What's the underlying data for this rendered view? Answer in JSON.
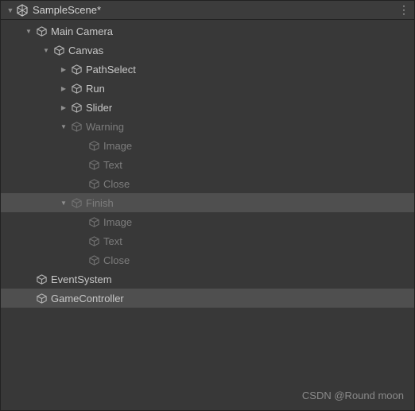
{
  "header": {
    "title": "SampleScene*"
  },
  "tree": {
    "mainCamera": "Main Camera",
    "canvas": "Canvas",
    "pathSelect": "PathSelect",
    "run": "Run",
    "slider": "Slider",
    "warning": "Warning",
    "warningImage": "Image",
    "warningText": "Text",
    "warningClose": "Close",
    "finish": "Finish",
    "finishImage": "Image",
    "finishText": "Text",
    "finishClose": "Close",
    "eventSystem": "EventSystem",
    "gameController": "GameController"
  },
  "watermark": "CSDN @Round moon"
}
